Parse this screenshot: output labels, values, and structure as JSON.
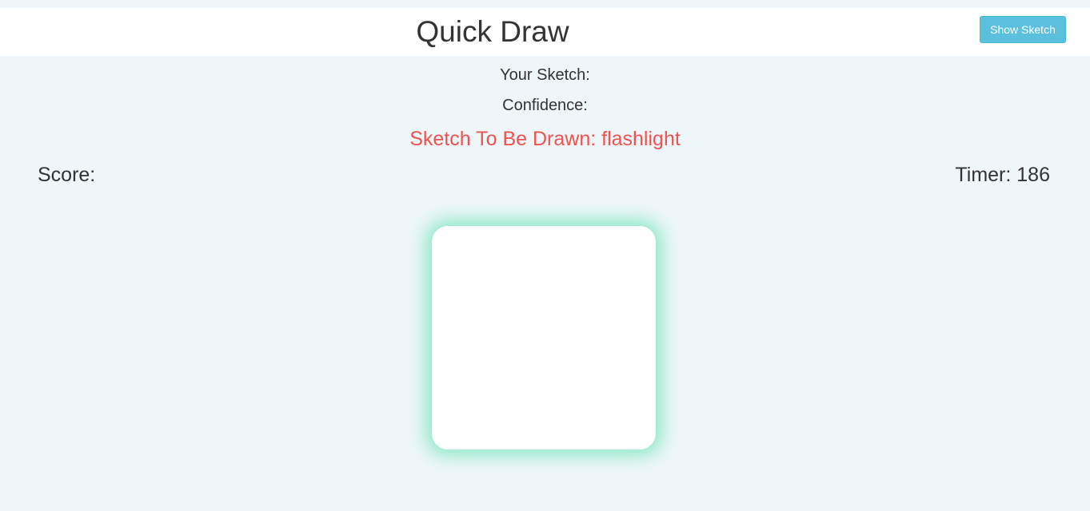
{
  "header": {
    "title": "Quick Draw",
    "show_sketch_label": "Show Sketch"
  },
  "status": {
    "your_sketch_label": "Your Sketch:",
    "confidence_label": "Confidence:",
    "target_prefix": "Sketch To Be Drawn:",
    "target_word": "flashlight"
  },
  "game": {
    "score_label": "Score:",
    "timer_label": "Timer:",
    "timer_value": "186"
  },
  "colors": {
    "background": "#eef6f9",
    "header_bg": "#ffffff",
    "button_bg": "#5bc0de",
    "target_text": "#ef5350",
    "canvas_glow": "#8ee8c6"
  }
}
